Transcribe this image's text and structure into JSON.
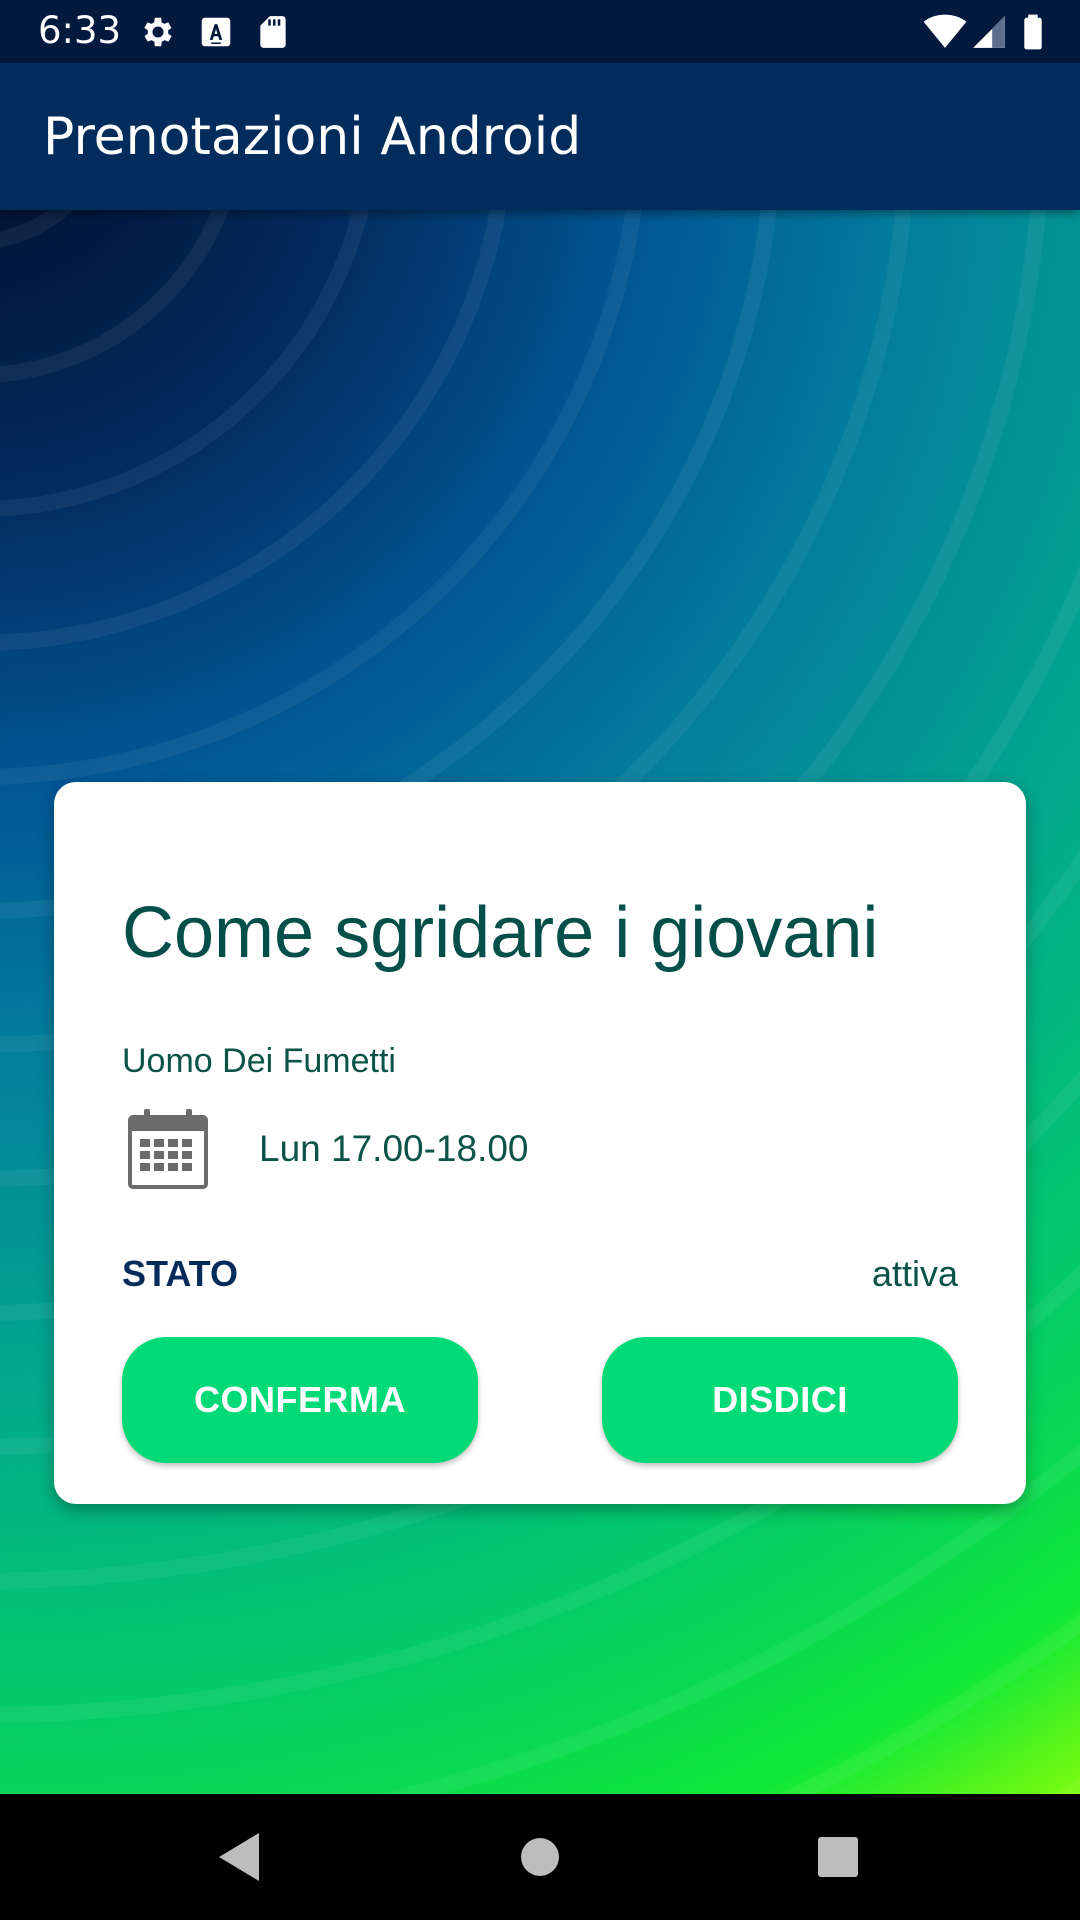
{
  "status_bar": {
    "time": "6:33",
    "left_icons": [
      "gear-icon",
      "font-a-icon",
      "sd-card-icon"
    ],
    "right_icons": [
      "wifi-icon",
      "cell-signal-icon",
      "battery-icon"
    ]
  },
  "app_bar": {
    "title": "Prenotazioni Android"
  },
  "booking": {
    "title": "Come sgridare i giovani",
    "author": "Uomo Dei Fumetti",
    "calendar_icon": "calendar-icon",
    "time": "Lun 17.00-18.00",
    "status_label": "STATO",
    "status_value": "attiva",
    "confirm_label": "CONFERMA",
    "cancel_label": "DISDICI"
  },
  "nav_bar": {
    "icons": [
      "back-triangle-icon",
      "home-circle-icon",
      "recents-square-icon"
    ]
  },
  "colors": {
    "status_bar": "#031a3e",
    "app_bar": "#022c5c",
    "title_text": "#054f4a",
    "status_label": "#052b5a",
    "button": "#02d977"
  }
}
